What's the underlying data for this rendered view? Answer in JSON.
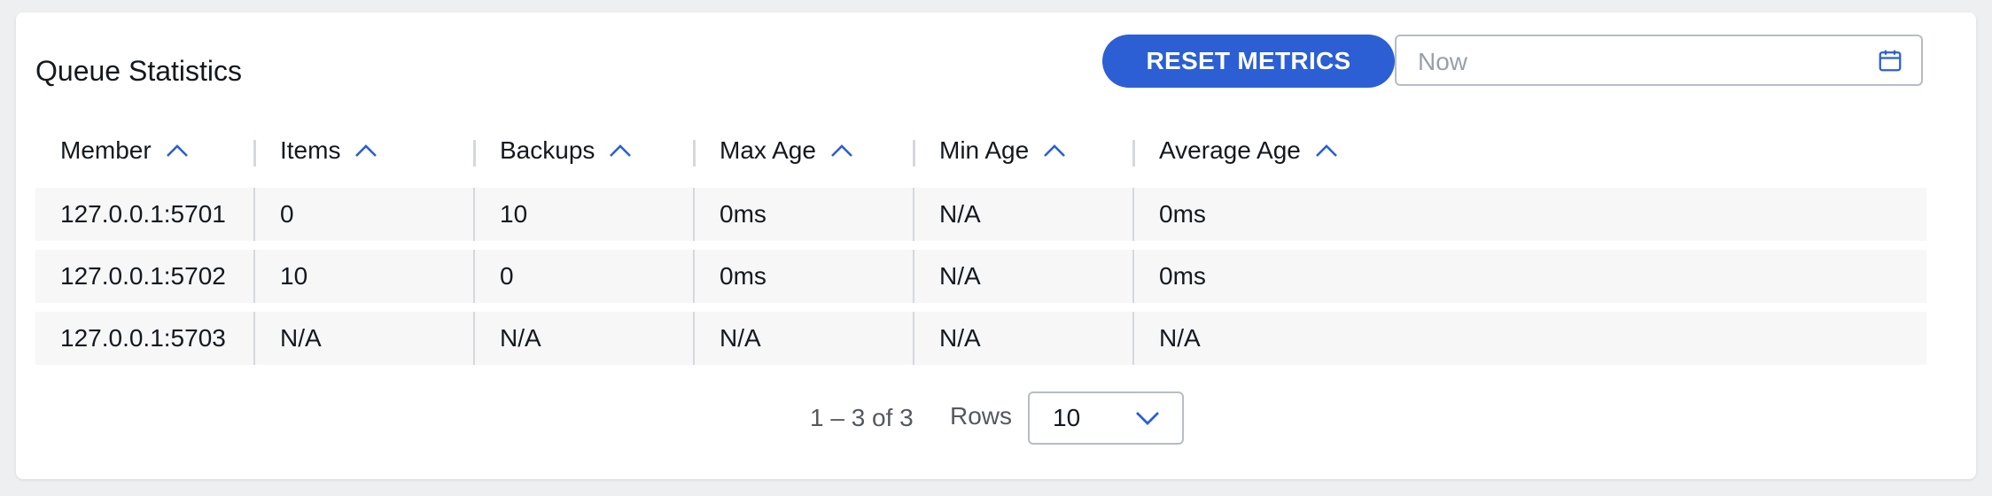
{
  "panel": {
    "title": "Queue Statistics",
    "reset_label": "RESET METRICS",
    "date_placeholder": "Now",
    "date_value": ""
  },
  "table": {
    "columns": [
      "Member",
      "Items",
      "Backups",
      "Max Age",
      "Min Age",
      "Average Age"
    ],
    "rows": [
      [
        "127.0.0.1:5701",
        "0",
        "10",
        "0ms",
        "N/A",
        "0ms"
      ],
      [
        "127.0.0.1:5702",
        "10",
        "0",
        "0ms",
        "N/A",
        "0ms"
      ],
      [
        "127.0.0.1:5703",
        "N/A",
        "N/A",
        "N/A",
        "N/A",
        "N/A"
      ]
    ]
  },
  "pagination": {
    "range": "1 – 3 of 3",
    "rows_label": "Rows",
    "rows_per_page": "10"
  },
  "colors": {
    "accent": "#2b5fd3",
    "row_bg": "#f7f7f8"
  }
}
